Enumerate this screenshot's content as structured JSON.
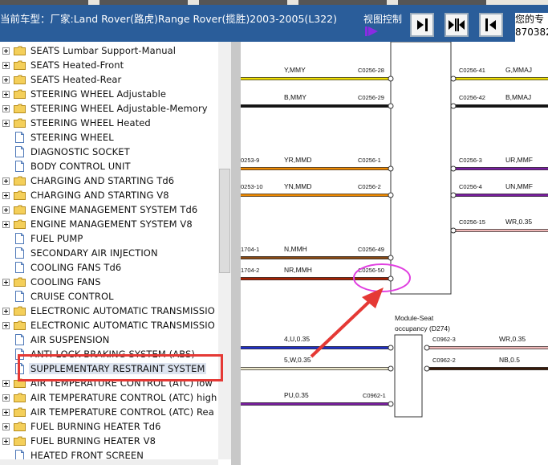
{
  "header": {
    "title": "当前车型：厂家:Land Rover(路虎)Range Rover(揽胜)2003-2005(L322)",
    "view_control_label": "视图控制",
    "user_line1": "您的专",
    "user_line2": "870382"
  },
  "tree": {
    "items": [
      {
        "label": "SEATS Lumbar Support-Manual",
        "type": "folder"
      },
      {
        "label": "SEATS Heated-Front",
        "type": "folder"
      },
      {
        "label": "SEATS Heated-Rear",
        "type": "folder"
      },
      {
        "label": "STEERING WHEEL Adjustable",
        "type": "folder"
      },
      {
        "label": "STEERING WHEEL Adjustable-Memory",
        "type": "folder"
      },
      {
        "label": "STEERING WHEEL Heated",
        "type": "folder"
      },
      {
        "label": "STEERING WHEEL",
        "type": "doc"
      },
      {
        "label": "DIAGNOSTIC SOCKET",
        "type": "doc"
      },
      {
        "label": "BODY CONTROL UNIT",
        "type": "doc"
      },
      {
        "label": "CHARGING AND STARTING Td6",
        "type": "folder"
      },
      {
        "label": "CHARGING AND STARTING V8",
        "type": "folder"
      },
      {
        "label": "ENGINE MANAGEMENT SYSTEM Td6",
        "type": "folder"
      },
      {
        "label": "ENGINE MANAGEMENT SYSTEM V8",
        "type": "folder"
      },
      {
        "label": "FUEL PUMP",
        "type": "doc"
      },
      {
        "label": "SECONDARY AIR INJECTION",
        "type": "doc"
      },
      {
        "label": "COOLING FANS Td6",
        "type": "doc"
      },
      {
        "label": "COOLING FANS",
        "type": "folder"
      },
      {
        "label": "CRUISE CONTROL",
        "type": "doc"
      },
      {
        "label": "ELECTRONIC AUTOMATIC TRANSMISSIO",
        "type": "folder"
      },
      {
        "label": "ELECTRONIC AUTOMATIC TRANSMISSIO",
        "type": "folder"
      },
      {
        "label": "AIR SUSPENSION",
        "type": "doc"
      },
      {
        "label": "ANTI-LOCK BRAKING SYSTEM (ABS)",
        "type": "doc"
      },
      {
        "label": "SUPPLEMENTARY RESTRAINT SYSTEM",
        "type": "doc",
        "selected": true
      },
      {
        "label": "AIR TEMPERATURE CONTROL (ATC) low",
        "type": "folder"
      },
      {
        "label": "AIR TEMPERATURE CONTROL (ATC) high",
        "type": "folder"
      },
      {
        "label": "AIR TEMPERATURE CONTROL (ATC) Rea",
        "type": "folder"
      },
      {
        "label": "FUEL BURNING HEATER Td6",
        "type": "folder"
      },
      {
        "label": "FUEL BURNING HEATER V8",
        "type": "folder"
      },
      {
        "label": "HEATED FRONT SCREEN",
        "type": "doc"
      }
    ]
  },
  "diagram": {
    "wire_labels_left": [
      "Y,MMY",
      "B,MMY",
      "YR,MMD",
      "YN,MMD",
      "N,MMH",
      "NR,MMH"
    ],
    "left_pins": [
      "C0256-28",
      "C0256-29",
      "C0256-1",
      "C0256-2",
      "C0256-49",
      "C0256-50"
    ],
    "far_left_refs": [
      "0253-9",
      "0253-10",
      "1704-1",
      "1704-2"
    ],
    "right_pins": [
      "C0256-41",
      "C0256-42",
      "C0256-3",
      "C0256-4",
      "C0256-15"
    ],
    "wire_labels_right": [
      "G,MMAJ",
      "B,MMAJ",
      "UR,MMF",
      "UN,MMF",
      "WR,0.35"
    ],
    "module_label_line1": "Module-Seat",
    "module_label_line2": "occupancy (D274)",
    "lower_left_labels": [
      "4,U,0.35",
      "5,W,0.35",
      "PU,0.35"
    ],
    "lower_left_pin": "C0962-1",
    "lower_right_pins": [
      "C0962-3",
      "C0962-2"
    ],
    "lower_right_labels": [
      "WR,0.35",
      "NB,0.5"
    ],
    "colors": {
      "yellow": "#f2e000",
      "black": "#111111",
      "orange": "#f08a00",
      "brown": "#8a4a14",
      "dark_red": "#a82000",
      "purple": "#7a1da0",
      "pink": "#f0b8b8",
      "blue": "#1f2fc8",
      "ivory": "#efeacc",
      "magenta_annotation": "#e040e0",
      "red_annotation": "#e53935"
    }
  }
}
